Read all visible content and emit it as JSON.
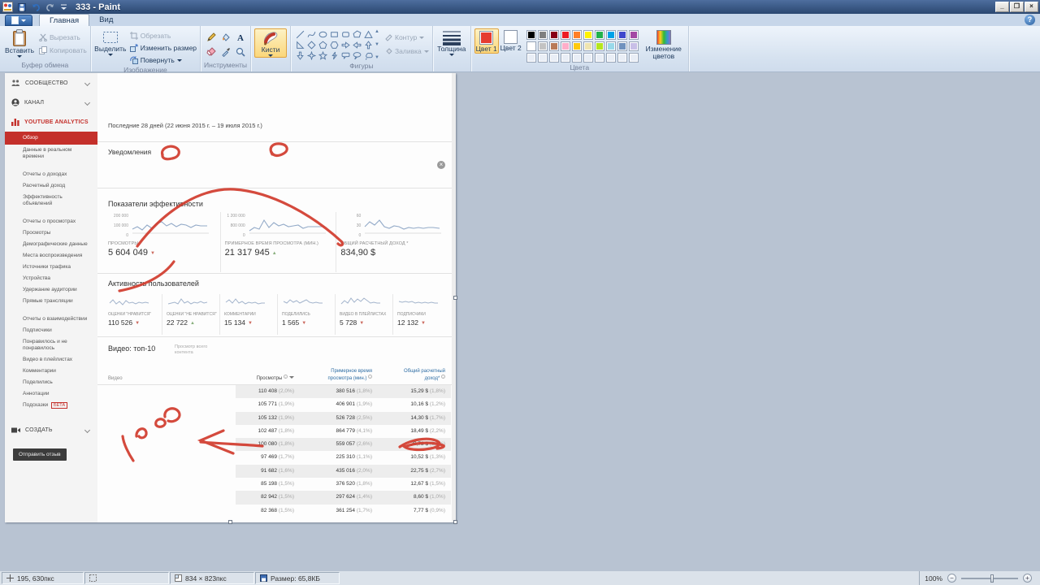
{
  "titlebar": {
    "title": "333 - Paint"
  },
  "tabs": {
    "home": "Главная",
    "view": "Вид"
  },
  "ribbon": {
    "paste": "Вставить",
    "cut": "Вырезать",
    "copy": "Копировать",
    "clipboard_group": "Буфер обмена",
    "select_btn": "Выделить",
    "crop": "Обрезать",
    "resize": "Изменить размер",
    "rotate": "Повернуть",
    "image_group": "Изображение",
    "tools_group": "Инструменты",
    "brushes": "Кисти",
    "shapes_group": "Фигуры",
    "outline": "Контур",
    "fill": "Заливка",
    "thickness": "Толщина",
    "color1_label": "Цвет 1",
    "color2_label": "Цвет 2",
    "colors_group": "Цвета",
    "edit_colors": "Изменение цветов",
    "color1": "#e53c30",
    "color2": "#ffffff",
    "palette_row1": [
      "#000000",
      "#7f7f7f",
      "#880015",
      "#ed1c24",
      "#ff7f27",
      "#fff200",
      "#22b14c",
      "#00a2e8",
      "#3f48cc",
      "#a349a4"
    ],
    "palette_row2": [
      "#ffffff",
      "#c3c3c3",
      "#b97a57",
      "#ffaec9",
      "#ffc90e",
      "#efe4b0",
      "#b5e61d",
      "#99d9ea",
      "#7092be",
      "#c8bfe7"
    ],
    "shape_icons": [
      "line",
      "curve",
      "ellipse",
      "rectangle",
      "rounded-rectangle",
      "polygon",
      "triangle",
      "right-triangle",
      "diamond",
      "pentagon",
      "hexagon",
      "right-arrow",
      "left-arrow",
      "up-arrow",
      "down-arrow",
      "four-point-star",
      "five-point-star",
      "lightning",
      "rounded-callout",
      "oval-callout",
      "cloud-callout"
    ]
  },
  "statusbar": {
    "cursor": "195, 630пкс",
    "dimensions": "834 × 823пкс",
    "filesize": "Размер: 65,8КБ",
    "zoom": "100%"
  },
  "yt": {
    "sidebar": {
      "community": "СООБЩЕСТВО",
      "channel": "КАНАЛ",
      "analytics": "YOUTUBE ANALYTICS",
      "items": [
        {
          "label": "Обзор",
          "active": true
        },
        {
          "label": "Данные в реальном времени"
        },
        {
          "label": "Отчеты о доходах",
          "gap": true
        },
        {
          "label": "Расчетный доход"
        },
        {
          "label": "Эффективность объявлений"
        },
        {
          "label": "Отчеты о просмотрах",
          "gap": true
        },
        {
          "label": "Просмотры"
        },
        {
          "label": "Демографические данные"
        },
        {
          "label": "Места воспроизведения"
        },
        {
          "label": "Источники трафика"
        },
        {
          "label": "Устройства"
        },
        {
          "label": "Удержание аудитории"
        },
        {
          "label": "Прямые трансляции"
        },
        {
          "label": "Отчеты о взаимодействии",
          "gap": true
        },
        {
          "label": "Подписчики"
        },
        {
          "label": "Понравилось и не понравилось"
        },
        {
          "label": "Видео в плейлистах"
        },
        {
          "label": "Комментарии"
        },
        {
          "label": "Поделились"
        },
        {
          "label": "Аннотации"
        },
        {
          "label": "Подсказки",
          "beta": true
        }
      ],
      "beta": "БЕТА",
      "create": "СОЗДАТЬ",
      "feedback": "Отправить отзыв"
    },
    "date_range": "Последние 28 дней (22 июня 2015 г. – 19 июля 2015 г.)",
    "notifications_title": "Уведомления",
    "performance": {
      "title": "Показатели эффективности",
      "cards": [
        {
          "label": "ПРОСМОТРЫ",
          "value": "5 604 049",
          "trend": "down",
          "axis": [
            "200 000",
            "100 000",
            "0"
          ]
        },
        {
          "label": "ПРИМЕРНОЕ ВРЕМЯ ПРОСМОТРА (МИН.)",
          "value": "21 317 945",
          "trend": "up",
          "axis": [
            "1 200 000",
            "800 000",
            "0"
          ]
        },
        {
          "label": "ОБЩИЙ РАСЧЕТНЫЙ ДОХОД *",
          "value": "834,90 $",
          "trend": "none",
          "axis": [
            "60",
            "30",
            "0"
          ]
        }
      ]
    },
    "engagement": {
      "title": "Активность пользователей",
      "cards": [
        {
          "label": "ОЦЕНКИ \"НРАВИТСЯ\"",
          "value": "110 526",
          "trend": "down"
        },
        {
          "label": "ОЦЕНКИ \"НЕ НРАВИТСЯ\"",
          "value": "22 722",
          "trend": "up"
        },
        {
          "label": "КОММЕНТАРИИ",
          "value": "15 134",
          "trend": "down"
        },
        {
          "label": "ПОДЕЛИЛИСЬ",
          "value": "1 565",
          "trend": "down"
        },
        {
          "label": "ВИДЕО В ПЛЕЙЛИСТАХ",
          "value": "5 728",
          "trend": "down"
        },
        {
          "label": "ПОДПИСЧИКИ",
          "value": "12 132",
          "trend": "down"
        }
      ]
    },
    "videos": {
      "title": "Видео: топ-10",
      "subtitle": "Просмотр всего контента",
      "col_video": "Видео",
      "col_views": "Просмотры",
      "col_time": "Примерное время просмотра (мин.)",
      "col_revenue": "Общий расчетный доход*",
      "rows": [
        [
          "110 408",
          "(2,0%)",
          "380 516",
          "(1,8%)",
          "15,29 $",
          "(1,8%)"
        ],
        [
          "105 771",
          "(1,9%)",
          "406 901",
          "(1,9%)",
          "10,16 $",
          "(1,2%)"
        ],
        [
          "105 132",
          "(1,9%)",
          "526 728",
          "(2,5%)",
          "14,30 $",
          "(1,7%)"
        ],
        [
          "102 487",
          "(1,8%)",
          "864 779",
          "(4,1%)",
          "18,49 $",
          "(2,2%)"
        ],
        [
          "100 080",
          "(1,8%)",
          "559 057",
          "(2,6%)",
          "20,78 $",
          "(2,5%)"
        ],
        [
          "97 469",
          "(1,7%)",
          "225 310",
          "(1,1%)",
          "10,52 $",
          "(1,3%)"
        ],
        [
          "91 682",
          "(1,6%)",
          "435 016",
          "(2,0%)",
          "22,75 $",
          "(2,7%)"
        ],
        [
          "85 198",
          "(1,5%)",
          "376 520",
          "(1,8%)",
          "12,67 $",
          "(1,5%)"
        ],
        [
          "82 942",
          "(1,5%)",
          "297 624",
          "(1,4%)",
          "8,60 $",
          "(1,0%)"
        ],
        [
          "82 368",
          "(1,5%)",
          "361 254",
          "(1,7%)",
          "7,77 $",
          "(0,9%)"
        ]
      ]
    }
  }
}
